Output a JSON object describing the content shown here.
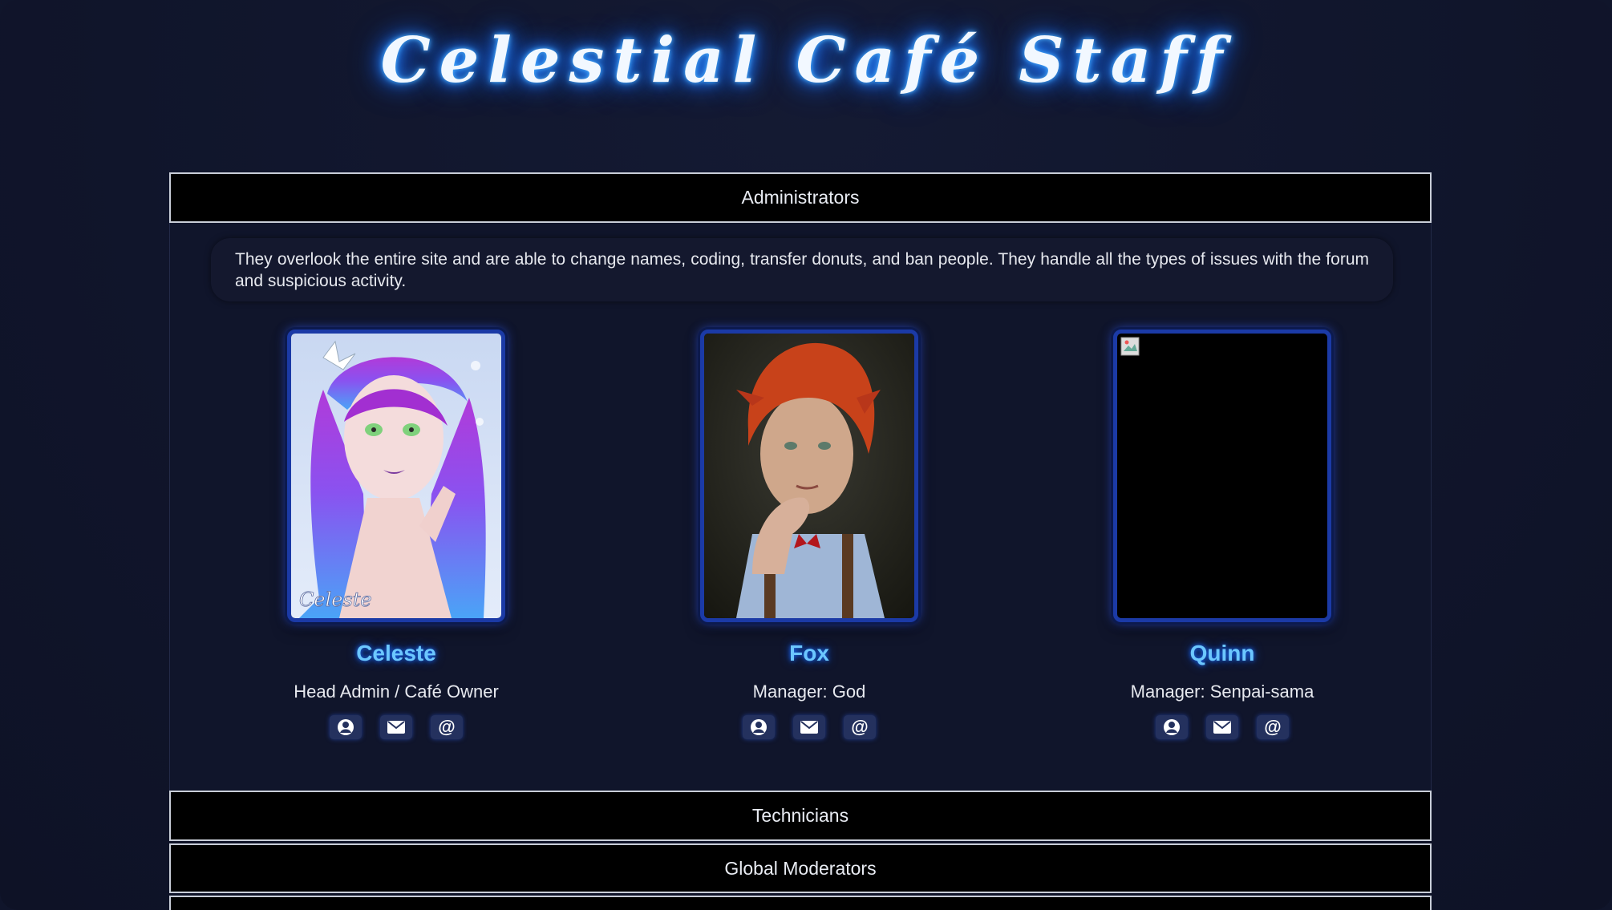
{
  "page": {
    "title": "Celestial Café Staff"
  },
  "sections": [
    {
      "label": "Administrators",
      "description": "They overlook the entire site and are able to change names, coding, transfer donuts, and ban people. They handle all the types of issues with the forum and suspicious activity.",
      "members": [
        {
          "name": "Celeste",
          "role": "Head Admin / Café Owner",
          "avatar": "celeste-portrait",
          "signature": "Celeste"
        },
        {
          "name": "Fox",
          "role": "Manager: God",
          "avatar": "fox-portrait"
        },
        {
          "name": "Quinn",
          "role": "Manager: Senpai-sama",
          "avatar": "broken-image"
        }
      ]
    },
    {
      "label": "Technicians"
    },
    {
      "label": "Global Moderators"
    }
  ],
  "member_icons": [
    "profile-icon",
    "mail-icon",
    "at-icon"
  ],
  "icon_glyphs": {
    "at": "@"
  },
  "colors": {
    "background": "#10152b",
    "header_bg": "#000000",
    "name_color": "#6cc7ff",
    "avatar_border": "#1b3aa6",
    "title_glow": "#2a8dff"
  }
}
